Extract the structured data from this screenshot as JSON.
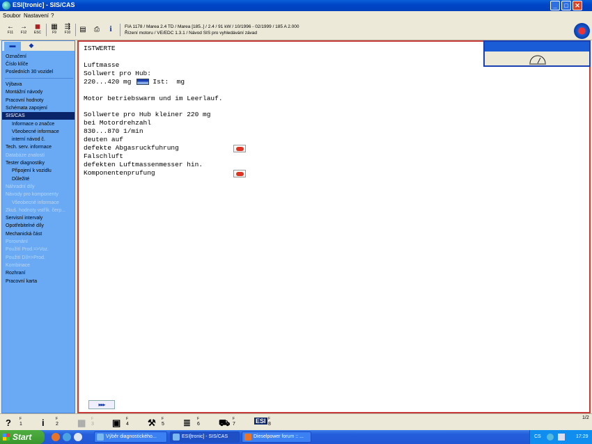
{
  "window": {
    "title": "ESI[tronic] - SIS/CAS",
    "minimize": "_",
    "maximize": "□",
    "close": "✕"
  },
  "menu": [
    "Soubor",
    "Nastavení",
    "?"
  ],
  "toolbar": {
    "buttons": [
      {
        "icon": "arrow-left-icon",
        "glyph": "←",
        "key": "F11"
      },
      {
        "icon": "arrow-right-icon",
        "glyph": "→",
        "key": "F12"
      },
      {
        "icon": "esc-icon",
        "glyph": "◼",
        "key": "ESC"
      },
      {
        "icon": "grid-icon",
        "glyph": "▦",
        "key": "F9"
      },
      {
        "icon": "tree-icon",
        "glyph": "⇶",
        "key": "F10"
      },
      {
        "icon": "document-icon",
        "glyph": "▤",
        "key": ""
      },
      {
        "icon": "printer-icon",
        "glyph": "⎙",
        "key": ""
      },
      {
        "icon": "info-icon",
        "glyph": "i",
        "key": ""
      }
    ],
    "vehicle_info": "FIA 1178 / Marea 2.4 TD / Marea [185..] / 2.4 / 91 kW / 10/1996 - 02/1999 / 185 A 2.000",
    "system_info": "Řízení motoru / VE/EDC 1.3.1 / Návod SIS pro vyhledávání závad"
  },
  "sidebar": {
    "tabs": [
      {
        "glyph": "▬"
      },
      {
        "glyph": "◆"
      }
    ],
    "group1": [
      "Označení",
      "Číslo klíče",
      "Posledních 30 vozidel"
    ],
    "group2": [
      {
        "label": "Výbava",
        "level": 0,
        "state": "normal"
      },
      {
        "label": "Montážní návody",
        "level": 0,
        "state": "normal"
      },
      {
        "label": "Pracovní hodnoty",
        "level": 0,
        "state": "normal"
      },
      {
        "label": "Schémata zapojení",
        "level": 0,
        "state": "normal"
      },
      {
        "label": "SIS/CAS",
        "level": 0,
        "state": "selected"
      },
      {
        "label": "Informace o značce",
        "level": 1,
        "state": "normal"
      },
      {
        "label": "Všeobecné informace",
        "level": 1,
        "state": "normal"
      },
      {
        "label": "interní návod č.",
        "level": 1,
        "state": "normal"
      },
      {
        "label": "Tech. serv. informace",
        "level": 0,
        "state": "normal"
      },
      {
        "label": "Databáze znalostí",
        "level": 0,
        "state": "disabled"
      },
      {
        "label": "Tester diagnostiky",
        "level": 0,
        "state": "normal"
      },
      {
        "label": "Připojení k vozidlu",
        "level": 1,
        "state": "normal"
      },
      {
        "label": "Důležité",
        "level": 1,
        "state": "normal"
      },
      {
        "label": "Náhradní díly",
        "level": 0,
        "state": "disabled"
      },
      {
        "label": "Návody pro komponenty",
        "level": 0,
        "state": "disabled"
      },
      {
        "label": "Všeobecné informace",
        "level": 1,
        "state": "disabled"
      },
      {
        "label": "Zkuš. hodnoty vstřík. čerp...",
        "level": 0,
        "state": "disabled"
      },
      {
        "label": "Servisní intervaly",
        "level": 0,
        "state": "normal"
      },
      {
        "label": "Opotřebitelné díly",
        "level": 0,
        "state": "normal"
      },
      {
        "label": "Mechanická část",
        "level": 0,
        "state": "normal"
      },
      {
        "label": "Porovnání",
        "level": 0,
        "state": "disabled"
      },
      {
        "label": "Použití Prod.=>Voz.",
        "level": 0,
        "state": "disabled"
      },
      {
        "label": "Použití Díl=>Prod.",
        "level": 0,
        "state": "disabled"
      },
      {
        "label": "Kombinace",
        "level": 0,
        "state": "disabled"
      },
      {
        "label": "Rozhraní",
        "level": 0,
        "state": "normal"
      },
      {
        "label": "Pracovní karta",
        "level": 0,
        "state": "normal"
      }
    ]
  },
  "content": {
    "heading": "ISTWERTE",
    "lines": [
      {
        "text": "Luftmasse"
      },
      {
        "text": "Sollwert pro Hub:"
      },
      {
        "text": "220...420 mg",
        "after": "Ist:  mg",
        "flag": true
      },
      {
        "text": ""
      },
      {
        "text": "Motor betriebswarm und im Leerlauf."
      },
      {
        "text": ""
      },
      {
        "text": "Sollwerte pro Hub kleiner 220 mg"
      },
      {
        "text": "bei Motordrehzahl"
      },
      {
        "text": "830...870 1/min"
      },
      {
        "text": "deuten auf"
      },
      {
        "text": "defekte Abgasruckfuhrung",
        "link": true
      },
      {
        "text": "Falschluft"
      },
      {
        "text": "defekten Luftmassenmesser hin."
      },
      {
        "text": "Komponentenprufung",
        "link": true
      }
    ],
    "next_label": "▸▸▸"
  },
  "bottombar": {
    "buttons": [
      {
        "icon": "help-icon",
        "glyph": "?",
        "key": "F",
        "num": "1",
        "enabled": true
      },
      {
        "icon": "info-icon",
        "glyph": "i",
        "key": "F",
        "num": "2",
        "enabled": true
      },
      {
        "icon": "tree-icon",
        "glyph": "▦",
        "key": "F",
        "num": "3",
        "enabled": false
      },
      {
        "icon": "schematic-icon",
        "glyph": "▣",
        "key": "F",
        "num": "4",
        "enabled": true
      },
      {
        "icon": "tools-icon",
        "glyph": "⚒",
        "key": "F",
        "num": "5",
        "enabled": true
      },
      {
        "icon": "list-icon",
        "glyph": "≣",
        "key": "F",
        "num": "6",
        "enabled": true
      },
      {
        "icon": "car-icon",
        "glyph": "⛟",
        "key": "F",
        "num": "7",
        "enabled": true
      },
      {
        "icon": "esi-icon",
        "glyph": "ESI",
        "key": "F",
        "num": "8",
        "enabled": true
      }
    ],
    "page": "1/2"
  },
  "taskbar": {
    "start": "Start",
    "tasks": [
      {
        "label": "Výběr diagnostického...",
        "active": false
      },
      {
        "label": "ESI[tronic] - SIS/CAS",
        "active": true
      },
      {
        "label": "Dieselpower forum :: ...",
        "active": false
      }
    ],
    "lang": "CS",
    "clock": "17:29"
  },
  "colors": {
    "selection": "#0a246a",
    "sidebar": "#6aaaf4",
    "content_border": "#c63a3a",
    "taskbar": "#245edb"
  }
}
